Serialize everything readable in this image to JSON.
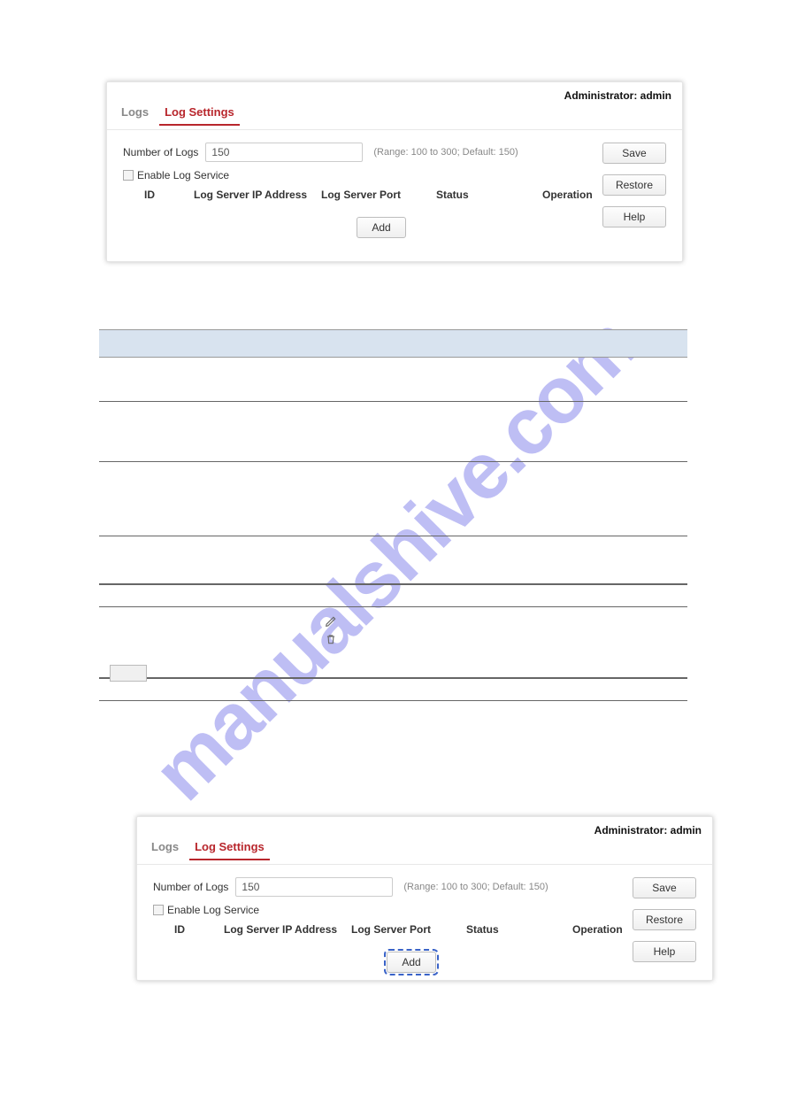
{
  "watermark_text": "manualshive.com",
  "admin_label": "Administrator: admin",
  "tabs": {
    "logs": "Logs",
    "log_settings": "Log Settings"
  },
  "panel": {
    "number_of_logs_label": "Number of Logs",
    "number_of_logs_value": "150",
    "range_hint": "(Range: 100 to 300; Default: 150)",
    "enable_log_service_label": "Enable Log Service",
    "columns": {
      "id": "ID",
      "ip": "Log Server IP Address",
      "port": "Log Server Port",
      "status": "Status",
      "operation": "Operation"
    },
    "buttons": {
      "add": "Add",
      "save": "Save",
      "restore": "Restore",
      "help": "Help"
    }
  },
  "icons": {
    "edit": "edit-icon",
    "trash": "trash-icon"
  }
}
